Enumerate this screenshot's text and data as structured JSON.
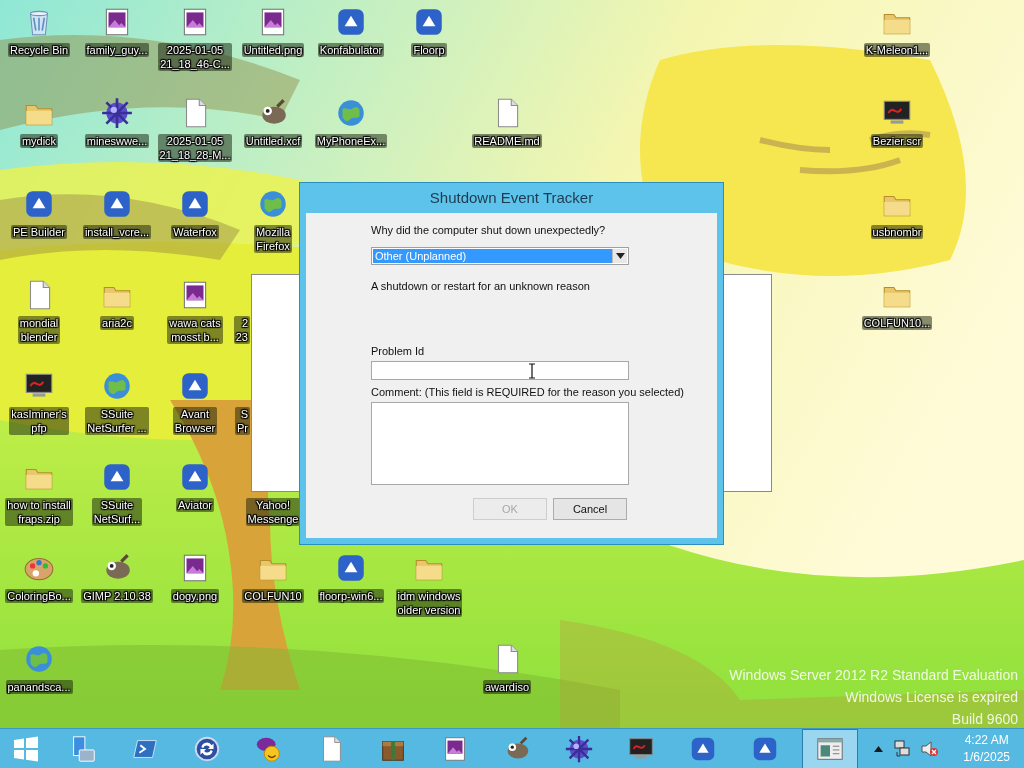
{
  "desktop": {
    "icons": [
      {
        "lines": [
          "Recycle Bin"
        ],
        "kind": "recycle-bin"
      },
      {
        "lines": [
          "mydick"
        ],
        "kind": "folder"
      },
      {
        "lines": [
          "PE Builder"
        ],
        "kind": "program"
      },
      {
        "lines": [
          "mondial",
          "blender"
        ],
        "kind": "document"
      },
      {
        "lines": [
          "kasIminer's",
          "pfp"
        ],
        "kind": "monitor"
      },
      {
        "lines": [
          "how to install",
          "fraps.zip"
        ],
        "kind": "folder"
      },
      {
        "lines": [
          "ColoringBo..."
        ],
        "kind": "paint"
      },
      {
        "lines": [
          "panandsca..."
        ],
        "kind": "globe"
      },
      {
        "lines": [
          "family_guy..."
        ],
        "kind": "image-file"
      },
      {
        "lines": [
          "mineswwe..."
        ],
        "kind": "ball"
      },
      {
        "lines": [
          "install_vcre..."
        ],
        "kind": "program"
      },
      {
        "lines": [
          "aria2c"
        ],
        "kind": "folder"
      },
      {
        "lines": [
          "SSuite",
          "NetSurfer ..."
        ],
        "kind": "globe"
      },
      {
        "lines": [
          "SSuite",
          "NetSurf..."
        ],
        "kind": "program"
      },
      {
        "lines": [
          "GIMP 2.10.38"
        ],
        "kind": "gimp"
      },
      {
        "lines": [
          "2025-01-05",
          "21_18_46-C..."
        ],
        "kind": "image-file"
      },
      {
        "lines": [
          "2025-01-05",
          "21_18_28-M..."
        ],
        "kind": "document"
      },
      {
        "lines": [
          "Waterfox"
        ],
        "kind": "program"
      },
      {
        "lines": [
          "wawa cats",
          "mosst b..."
        ],
        "kind": "image-file"
      },
      {
        "lines": [
          "Avant",
          "Browser"
        ],
        "kind": "program"
      },
      {
        "lines": [
          "Aviator"
        ],
        "kind": "program"
      },
      {
        "lines": [
          "dogy.png"
        ],
        "kind": "image-file"
      },
      {
        "lines": [
          "Untitled.png"
        ],
        "kind": "image-file"
      },
      {
        "lines": [
          "Untitled.xcf"
        ],
        "kind": "gimp"
      },
      {
        "lines": [
          "Mozilla",
          "Firefox"
        ],
        "kind": "globe"
      },
      {
        "lines": [
          "2",
          "23"
        ]
      },
      {
        "lines": [
          "S",
          "Pr"
        ]
      },
      {
        "lines": [
          "Yahoo!",
          "Messenge"
        ]
      },
      {
        "lines": [
          "COLFUN10"
        ],
        "kind": "folder"
      },
      {
        "lines": [
          "Konfabulator"
        ],
        "kind": "program"
      },
      {
        "lines": [
          "MyPhoneEx..."
        ],
        "kind": "globe"
      },
      {
        "lines": [
          "floorp-win6..."
        ],
        "kind": "program"
      },
      {
        "lines": [
          "Floorp"
        ],
        "kind": "program"
      },
      {
        "lines": [
          "idm windows",
          "older version"
        ],
        "kind": "folder"
      },
      {
        "lines": [
          "README.md"
        ],
        "kind": "document"
      },
      {
        "lines": [
          "awardiso"
        ],
        "kind": "document"
      },
      {
        "lines": [
          "K-Meleon1..."
        ],
        "kind": "folder"
      },
      {
        "lines": [
          "Bezier.scr"
        ],
        "kind": "monitor"
      },
      {
        "lines": [
          "usbnombr"
        ],
        "kind": "folder"
      },
      {
        "lines": [
          "COLFUN10..."
        ],
        "kind": "folder"
      }
    ],
    "watermark": [
      "Windows Server 2012 R2 Standard Evaluation",
      "Windows License is expired",
      "Build 9600"
    ]
  },
  "dialog": {
    "title": "Shutdown Event Tracker",
    "question": "Why did the computer shut down unexpectedly?",
    "reason": {
      "value": "Other (Unplanned)",
      "highlighted": true
    },
    "description": "A shutdown or restart for an unknown reason",
    "problem_id": {
      "label": "Problem Id"
    },
    "comment": {
      "label": "Comment: (This field is REQUIRED for the reason you selected)"
    },
    "buttons": [
      {
        "label": "OK",
        "disabled": true
      },
      {
        "label": "Cancel",
        "disabled": false
      }
    ]
  },
  "taskbar": {
    "apps": [
      {
        "kind": "server",
        "selected": false
      },
      {
        "kind": "terminal",
        "selected": false
      },
      {
        "kind": "sync",
        "selected": false
      },
      {
        "kind": "chat",
        "selected": false
      },
      {
        "kind": "document",
        "selected": false
      },
      {
        "kind": "archive",
        "selected": false
      },
      {
        "kind": "image-file",
        "selected": false
      },
      {
        "kind": "gimp",
        "selected": false
      },
      {
        "kind": "ball",
        "selected": false
      },
      {
        "kind": "monitor",
        "selected": false
      },
      {
        "kind": "program",
        "selected": false
      },
      {
        "kind": "program",
        "selected": false
      },
      {
        "kind": "window",
        "selected": true
      }
    ],
    "clock": {
      "time": "4:22 AM",
      "date": "1/6/2025"
    }
  }
}
